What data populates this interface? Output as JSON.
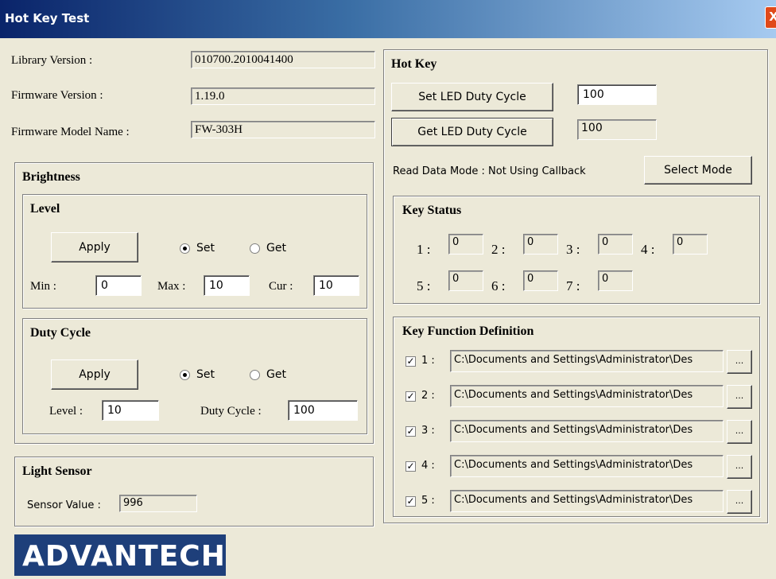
{
  "window": {
    "title": "Hot Key Test",
    "close_glyph": "X"
  },
  "info": {
    "library_label": "Library Version :",
    "library_value": "010700.2010041400",
    "firmware_label": "Firmware Version :",
    "firmware_value": "1.19.0",
    "model_label": "Firmware Model Name :",
    "model_value": "FW-303H"
  },
  "brightness": {
    "title": "Brightness",
    "level": {
      "title": "Level",
      "apply_label": "Apply",
      "set_label": "Set",
      "get_label": "Get",
      "selected": "Set",
      "min_label": "Min :",
      "min_value": "0",
      "max_label": "Max :",
      "max_value": "10",
      "cur_label": "Cur :",
      "cur_value": "10"
    },
    "duty": {
      "title": "Duty Cycle",
      "apply_label": "Apply",
      "set_label": "Set",
      "get_label": "Get",
      "selected": "Set",
      "level_label": "Level :",
      "level_value": "10",
      "duty_label": "Duty Cycle :",
      "duty_value": "100"
    }
  },
  "light_sensor": {
    "title": "Light Sensor",
    "label": "Sensor Value :",
    "value": "996"
  },
  "hotkey": {
    "title": "Hot Key",
    "set_led_label": "Set LED Duty Cycle",
    "set_led_value": "100",
    "get_led_label": "Get LED Duty Cycle",
    "get_led_value": "100",
    "read_mode_text": "Read Data Mode : Not Using Callback",
    "select_mode_label": "Select Mode"
  },
  "key_status": {
    "title": "Key Status",
    "keys": [
      {
        "label": "1 :",
        "value": "0"
      },
      {
        "label": "2 :",
        "value": "0"
      },
      {
        "label": "3 :",
        "value": "0"
      },
      {
        "label": "4 :",
        "value": "0"
      },
      {
        "label": "5 :",
        "value": "0"
      },
      {
        "label": "6 :",
        "value": "0"
      },
      {
        "label": "7 :",
        "value": "0"
      }
    ]
  },
  "key_function": {
    "title": "Key Function Definition",
    "browse_label": "...",
    "rows": [
      {
        "label": "1 :",
        "checked": true,
        "path": "C:\\Documents and Settings\\Administrator\\Des"
      },
      {
        "label": "2 :",
        "checked": true,
        "path": "C:\\Documents and Settings\\Administrator\\Des"
      },
      {
        "label": "3 :",
        "checked": true,
        "path": "C:\\Documents and Settings\\Administrator\\Des"
      },
      {
        "label": "4 :",
        "checked": true,
        "path": "C:\\Documents and Settings\\Administrator\\Des"
      },
      {
        "label": "5 :",
        "checked": true,
        "path": "C:\\Documents and Settings\\Administrator\\Des"
      }
    ]
  },
  "logo": {
    "text": "ADVANTECH"
  }
}
